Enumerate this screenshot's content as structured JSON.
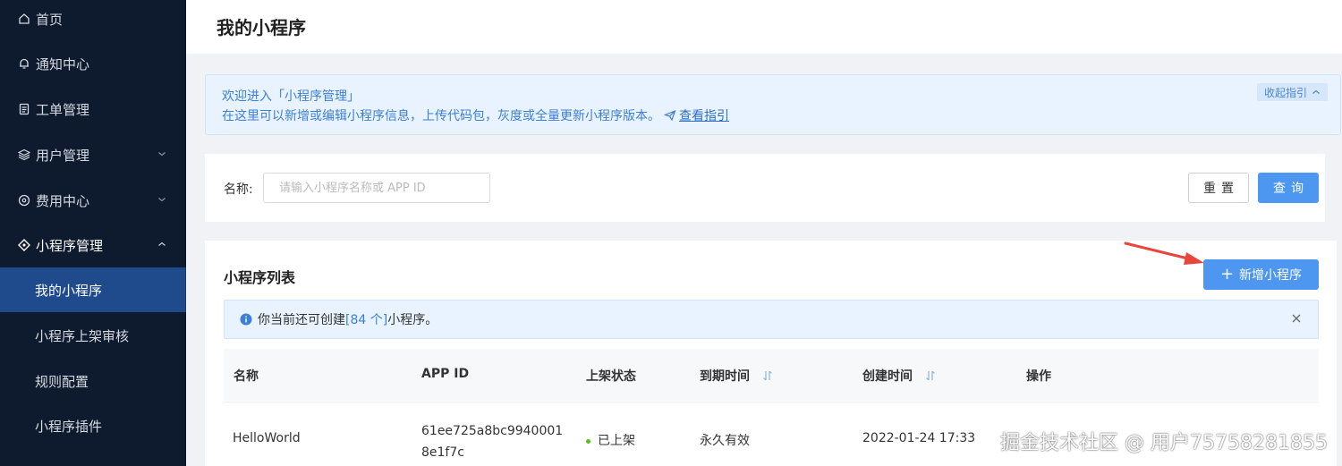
{
  "sidebar": {
    "items": [
      {
        "label": "首页",
        "icon": "home-icon"
      },
      {
        "label": "通知中心",
        "icon": "bell-icon"
      },
      {
        "label": "工单管理",
        "icon": "ticket-icon"
      },
      {
        "label": "用户管理",
        "icon": "layers-icon"
      },
      {
        "label": "费用中心",
        "icon": "coin-icon"
      },
      {
        "label": "小程序管理",
        "icon": "diamond-icon"
      }
    ],
    "sub_items": [
      {
        "label": "我的小程序"
      },
      {
        "label": "小程序上架审核"
      },
      {
        "label": "规则配置"
      },
      {
        "label": "小程序插件"
      }
    ]
  },
  "header": {
    "title": "我的小程序"
  },
  "guide": {
    "line1": "欢迎进入「小程序管理」",
    "line2": "在这里可以新增或编辑小程序信息，上传代码包，灰度或全量更新小程序版本。",
    "link": "查看指引",
    "collapse": "收起指引"
  },
  "search": {
    "label": "名称:",
    "placeholder": "请输入小程序名称或 APP ID",
    "reset": "重置",
    "query": "查询"
  },
  "list": {
    "title": "小程序列表",
    "add_button": "新增小程序",
    "info_prefix": "你当前还可创建",
    "info_count": "[84 个]",
    "info_suffix": "小程序。",
    "columns": [
      "名称",
      "APP ID",
      "上架状态",
      "到期时间",
      "创建时间",
      "操作"
    ],
    "rows": [
      {
        "name": "HelloWorld",
        "app_id_1": "61ee725a8bc9940001",
        "app_id_2": "8e1f7c",
        "status": "已上架",
        "expire": "永久有效",
        "created": "2022-01-24 17:33"
      }
    ]
  },
  "watermark": "掘金技术社区 @ 用户7575828​1855",
  "colors": {
    "sidebar_bg": "#0e1a2e",
    "active_bg": "#1f4b8c",
    "primary": "#4d97f0",
    "info_bg": "#e8f3ff",
    "success": "#52c41a",
    "arrow": "#e8453c"
  }
}
